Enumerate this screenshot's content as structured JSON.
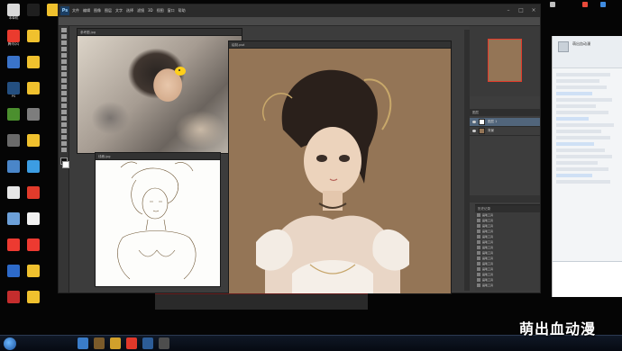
{
  "desktop": {
    "icons": [
      {
        "label": "本单机",
        "color": "#d9d9d9"
      },
      {
        "label": "腾讯QQ",
        "color": "#ea3b2e"
      },
      {
        "label": "",
        "color": "#3a73c9"
      },
      {
        "label": "PS",
        "color": "#244f80"
      },
      {
        "label": "",
        "color": "#4b8f2e"
      },
      {
        "label": "",
        "color": "#6a6a6a"
      },
      {
        "label": "",
        "color": "#4a86c9"
      },
      {
        "label": "",
        "color": "#e7e7e7"
      },
      {
        "label": "",
        "color": "#6ca0d9"
      },
      {
        "label": "",
        "color": "#ed3a31"
      },
      {
        "label": "",
        "color": "#2d6ac9"
      },
      {
        "label": "",
        "color": "#c42d2d"
      },
      {
        "label": "",
        "color": "#1f1f1f"
      },
      {
        "label": "",
        "color": "#f0c12e"
      },
      {
        "label": "",
        "color": "#f0c12e"
      },
      {
        "label": "",
        "color": "#f0c12e"
      },
      {
        "label": "",
        "color": "#7d7d7d"
      },
      {
        "label": "",
        "color": "#f0c12e"
      },
      {
        "label": "",
        "color": "#3c9de3"
      },
      {
        "label": "",
        "color": "#e23b2b"
      },
      {
        "label": "",
        "color": "#f2f2f2"
      },
      {
        "label": "",
        "color": "#ed3a31"
      },
      {
        "label": "",
        "color": "#f0c12e"
      },
      {
        "label": "",
        "color": "#f0c12e"
      },
      {
        "label": "",
        "color": "#f0c12e"
      }
    ]
  },
  "photoshop": {
    "logo": "Ps",
    "menus": [
      "文件",
      "编辑",
      "图像",
      "图层",
      "文字",
      "选择",
      "滤镜",
      "3D",
      "视图",
      "窗口",
      "帮助"
    ],
    "documents": [
      {
        "tab": "参考图.jpg"
      },
      {
        "tab": "线稿.jpg"
      },
      {
        "tab": "绘制.psd"
      }
    ],
    "layers_head": "图层",
    "layers": [
      {
        "name": "图层 1"
      },
      {
        "name": "背景"
      }
    ],
    "history_head": "历史记录",
    "history_items": [
      "画笔工具",
      "画笔工具",
      "画笔工具",
      "画笔工具",
      "画笔工具",
      "画笔工具",
      "画笔工具",
      "画笔工具",
      "画笔工具",
      "画笔工具",
      "画笔工具",
      "画笔工具",
      "画笔工具",
      "画笔工具"
    ]
  },
  "chat": {
    "title": "萌出血动漫",
    "subtitle": "",
    "messages": []
  },
  "taskbar": {
    "buttons": [
      {
        "color": "#3a7cc8"
      },
      {
        "color": "#7a5a2a"
      },
      {
        "color": "#d1a02b"
      },
      {
        "color": "#e1382a"
      },
      {
        "color": "#2c5c97"
      },
      {
        "color": "#4d4d4d"
      }
    ],
    "clock": "",
    "date": ""
  },
  "watermark": "萌出血动漫"
}
